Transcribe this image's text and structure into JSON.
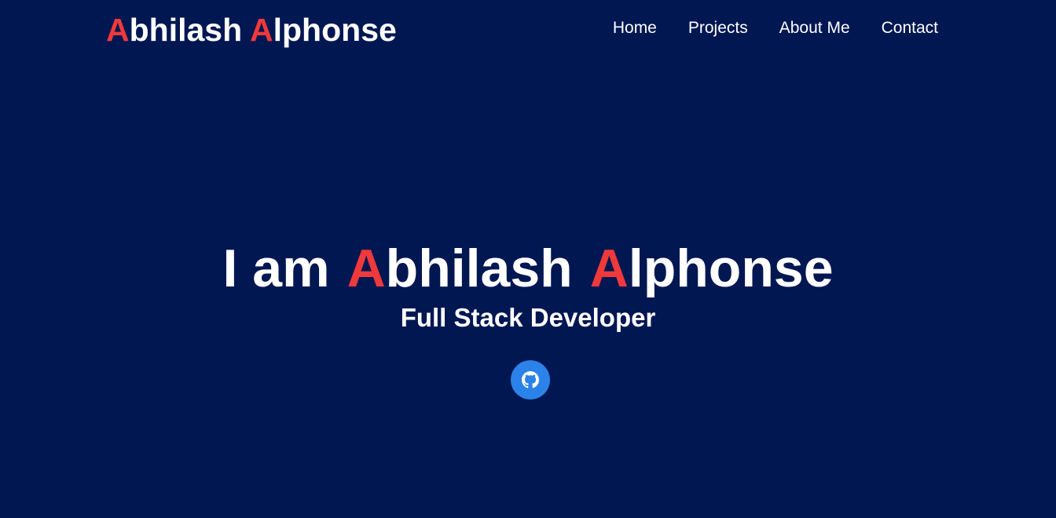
{
  "header": {
    "brand": {
      "first_initial": "A",
      "first_rest": "bhilash",
      "last_initial": "A",
      "last_rest": "lphonse"
    },
    "nav": [
      {
        "label": "Home"
      },
      {
        "label": "Projects"
      },
      {
        "label": "About Me"
      },
      {
        "label": "Contact"
      }
    ]
  },
  "hero": {
    "prefix": "I am",
    "first_initial": "A",
    "first_rest": "bhilash",
    "last_initial": "A",
    "last_rest": "lphonse",
    "subtitle": "Full Stack Developer"
  },
  "social": {
    "github_icon": "github-icon"
  },
  "colors": {
    "background": "#001752",
    "accent": "#f0393b",
    "button": "#2b82e8",
    "text": "#ffffff"
  }
}
